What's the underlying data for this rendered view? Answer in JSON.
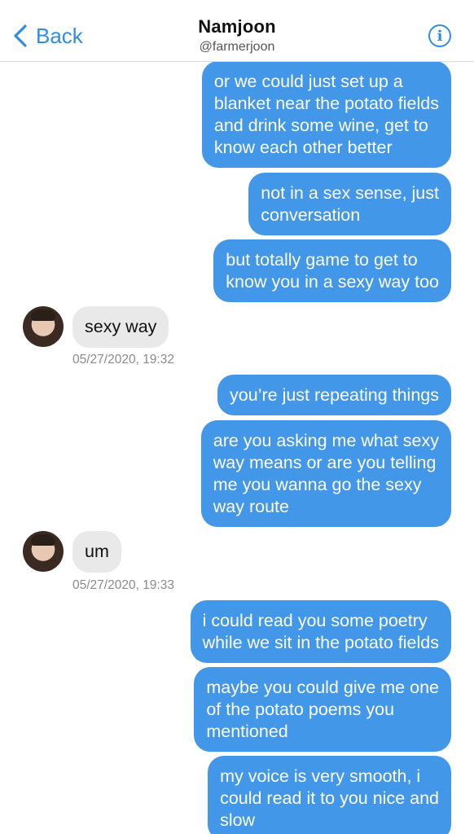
{
  "header": {
    "back_label": "Back",
    "title": "Namjoon",
    "handle": "@farmerjoon",
    "info_glyph": "i"
  },
  "messages": [
    {
      "dir": "out",
      "lines": [
        "or we could just set up a",
        "blanket near the potato fields",
        "and drink some wine, get to",
        "know each other better"
      ]
    },
    {
      "dir": "out",
      "lines": [
        "not in a sex sense, just",
        "conversation"
      ]
    },
    {
      "dir": "out",
      "lines": [
        "but totally game to get to",
        "know you in a sexy way too"
      ]
    },
    {
      "dir": "in",
      "lines": [
        "sexy way"
      ],
      "timestamp": "05/27/2020, 19:32"
    },
    {
      "dir": "out",
      "lines": [
        "you’re just repeating things"
      ]
    },
    {
      "dir": "out",
      "lines": [
        "are you asking me what sexy",
        "way means or are you telling",
        "me you wanna go the sexy",
        "way route"
      ]
    },
    {
      "dir": "in",
      "lines": [
        "um"
      ],
      "timestamp": "05/27/2020, 19:33"
    },
    {
      "dir": "out",
      "lines": [
        "i could read you some poetry",
        "while we sit in the potato fields"
      ]
    },
    {
      "dir": "out",
      "lines": [
        "maybe you could give me one",
        "of the potato poems you",
        "mentioned"
      ]
    },
    {
      "dir": "out",
      "lines": [
        "my voice is very smooth, i",
        "could read it to you nice and",
        "slow"
      ]
    }
  ],
  "colors": {
    "accent": "#2f8de4",
    "outgoing_bubble": "#4297e8",
    "incoming_bubble": "#e9e9ea"
  },
  "icons": {
    "back": "chevron-left-icon",
    "info": "info-icon"
  }
}
